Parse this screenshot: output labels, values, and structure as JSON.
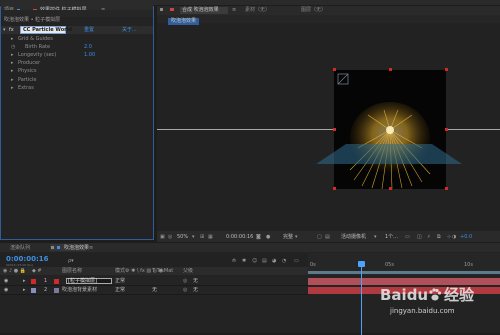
{
  "colors": {
    "accent_blue": "#3e8fe2",
    "selection_border": "#2f5d9a",
    "handle_red": "#d2292c",
    "playhead": "#4ea1ff",
    "layer1_bar": "#b0505a",
    "layer2_bar": "#b03a3f",
    "particle_gold": "#e8b230",
    "plane_blue": "#2e6b8c"
  },
  "effects_panel": {
    "tab1": "项目",
    "tab2": "效果控件 粒子模拟层",
    "menu": "≡",
    "subtitle": "吹泡泡效果 • 粒子模拟层",
    "effect_row": {
      "fx": "fx",
      "name": "CC Particle World",
      "reset": "重置",
      "about": "关于..."
    },
    "properties": [
      {
        "label": "Grid & Guides",
        "value": ""
      },
      {
        "label": "Birth Rate",
        "value": "2.0"
      },
      {
        "label": "Longevity (sec)",
        "value": "1.00"
      },
      {
        "label": "Producer",
        "value": ""
      },
      {
        "label": "Physics",
        "value": ""
      },
      {
        "label": "Particle",
        "value": ""
      },
      {
        "label": "Extras",
        "value": ""
      }
    ]
  },
  "comp_panel": {
    "tab": "合成 吹泡泡效果",
    "tab_menu": "≡",
    "footage_tab": "素材（无）",
    "layer_tab": "图层（无）",
    "subtab": "吹泡泡效果",
    "bottom_bar": {
      "zoom": "50%",
      "timecode": "0:00:00:16",
      "quality": "完整",
      "camera": "活动摄像机",
      "views": "1个...",
      "exposure": "+0.0"
    }
  },
  "timeline": {
    "tab1": "渲染队列",
    "tab2": "吹泡泡效果",
    "tab_menu": "≡",
    "timecode": "0:00:00:16",
    "frame_info": "00016 (25.00 fps)",
    "search_placeholder": "ρ▾",
    "columns": {
      "layer_name": "图层名称",
      "mode": "模式",
      "trkmat": "T TrkMat",
      "parent": "父级"
    },
    "ruler_ticks": [
      "0s",
      "05s",
      "10s"
    ],
    "layers": [
      {
        "num": "1",
        "name": "[粒子模拟层]",
        "mode": "正常",
        "trkmat": "",
        "parent": "无"
      },
      {
        "num": "2",
        "name": "吹泡泡背景素材",
        "mode": "正常",
        "trkmat": "无",
        "parent": "无"
      }
    ]
  },
  "watermark": {
    "brand_text": "Baidu",
    "brand_cn": "经验",
    "url": "jingyan.baidu.com"
  }
}
